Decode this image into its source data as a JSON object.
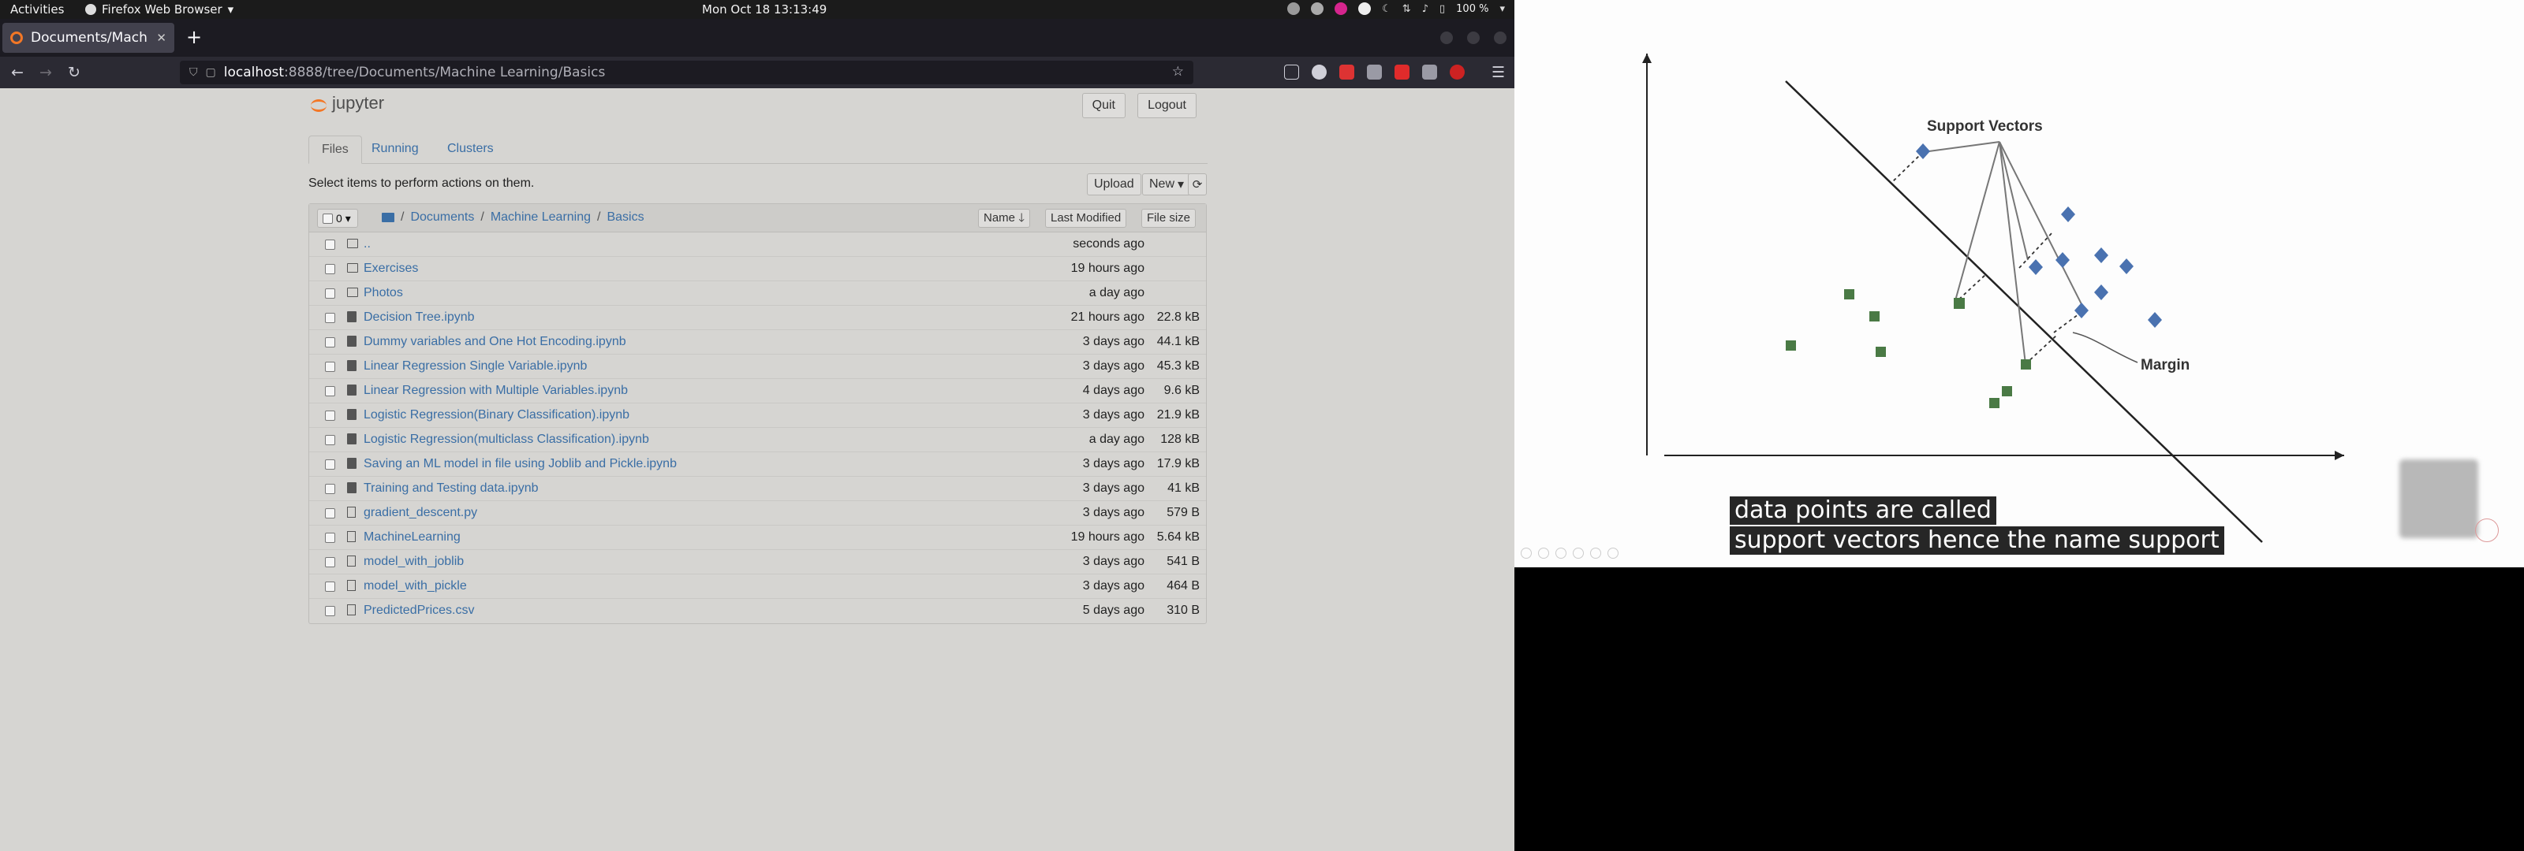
{
  "topbar": {
    "activities": "Activities",
    "app_name": "Firefox Web Browser",
    "clock": "Mon Oct 18  13:13:49",
    "battery": "100 %"
  },
  "browser": {
    "tab_title": "Documents/Machine",
    "url_host": "localhost",
    "url_path": ":8888/tree/Documents/Machine Learning/Basics"
  },
  "jupyter": {
    "logo_text": "jupyter",
    "quit_label": "Quit",
    "logout_label": "Logout",
    "tabs": [
      {
        "label": "Files"
      },
      {
        "label": "Running"
      },
      {
        "label": "Clusters"
      }
    ],
    "select_hint": "Select items to perform actions on them.",
    "upload_label": "Upload",
    "new_label": "New",
    "selected_count": "0",
    "breadcrumb": [
      "Documents",
      "Machine Learning",
      "Basics"
    ],
    "sort_name": "Name",
    "sort_modified": "Last Modified",
    "sort_size": "File size",
    "files": [
      {
        "type": "folder",
        "name": "..",
        "modified": "seconds ago",
        "size": ""
      },
      {
        "type": "folder",
        "name": "Exercises",
        "modified": "19 hours ago",
        "size": ""
      },
      {
        "type": "folder",
        "name": "Photos",
        "modified": "a day ago",
        "size": ""
      },
      {
        "type": "notebook",
        "name": "Decision Tree.ipynb",
        "modified": "21 hours ago",
        "size": "22.8 kB"
      },
      {
        "type": "notebook",
        "name": "Dummy variables and One Hot Encoding.ipynb",
        "modified": "3 days ago",
        "size": "44.1 kB"
      },
      {
        "type": "notebook",
        "name": "Linear Regression Single Variable.ipynb",
        "modified": "3 days ago",
        "size": "45.3 kB"
      },
      {
        "type": "notebook",
        "name": "Linear Regression with Multiple Variables.ipynb",
        "modified": "4 days ago",
        "size": "9.6 kB"
      },
      {
        "type": "notebook",
        "name": "Logistic Regression(Binary Classification).ipynb",
        "modified": "3 days ago",
        "size": "21.9 kB"
      },
      {
        "type": "notebook",
        "name": "Logistic Regression(multiclass Classification).ipynb",
        "modified": "a day ago",
        "size": "128 kB"
      },
      {
        "type": "notebook",
        "name": "Saving an ML model in file using Joblib and Pickle.ipynb",
        "modified": "3 days ago",
        "size": "17.9 kB"
      },
      {
        "type": "notebook",
        "name": "Training and Testing data.ipynb",
        "modified": "3 days ago",
        "size": "41 kB"
      },
      {
        "type": "file",
        "name": "gradient_descent.py",
        "modified": "3 days ago",
        "size": "579 B"
      },
      {
        "type": "file",
        "name": "MachineLearning",
        "modified": "19 hours ago",
        "size": "5.64 kB"
      },
      {
        "type": "file",
        "name": "model_with_joblib",
        "modified": "3 days ago",
        "size": "541 B"
      },
      {
        "type": "file",
        "name": "model_with_pickle",
        "modified": "3 days ago",
        "size": "464 B"
      },
      {
        "type": "file",
        "name": "PredictedPrices.csv",
        "modified": "5 days ago",
        "size": "310 B"
      }
    ]
  },
  "video": {
    "slide_label_support": "Support Vectors",
    "slide_label_margin": "Margin",
    "caption_lines": [
      "data points are called",
      "support vectors hence the name support"
    ]
  },
  "colors": {
    "jupyter_link": "#3a6ea5",
    "square_points": "#4a7a45",
    "diamond_points": "#4a72b0"
  }
}
